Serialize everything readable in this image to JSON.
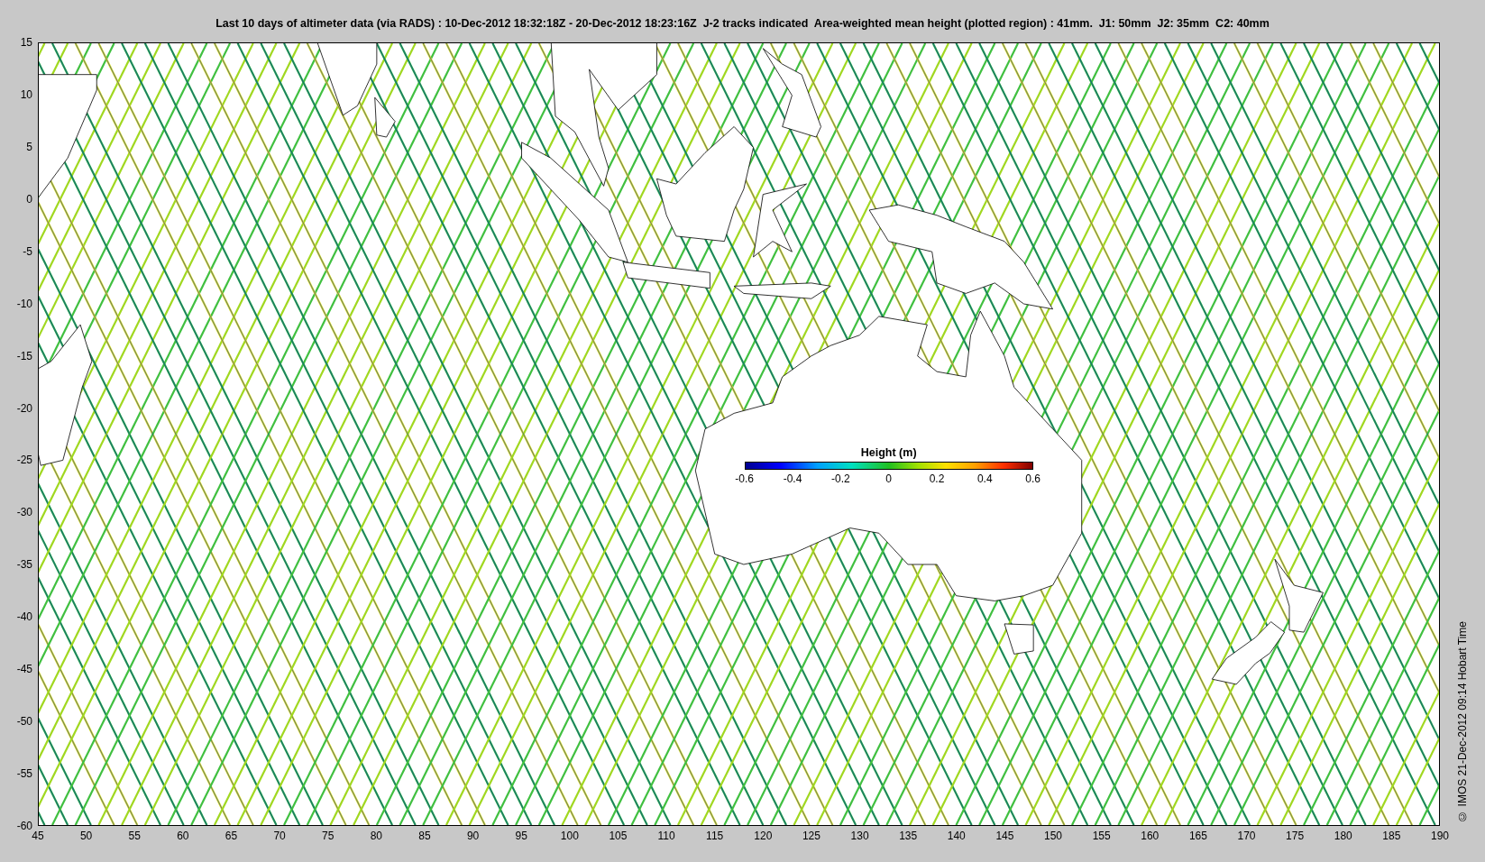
{
  "title": "Last 10 days of altimeter data (via RADS) : 10-Dec-2012 18:32:18Z - 20-Dec-2012 18:23:16Z  J-2 tracks indicated  Area-weighted mean height (plotted region) : 41mm.  J1: 50mm  J2: 35mm  C2: 40mm",
  "y_ticks": [
    "15",
    "10",
    "5",
    "0",
    "-5",
    "-10",
    "-15",
    "-20",
    "-25",
    "-30",
    "-35",
    "-40",
    "-45",
    "-50",
    "-55",
    "-60"
  ],
  "x_ticks": [
    "45",
    "50",
    "55",
    "60",
    "65",
    "70",
    "75",
    "80",
    "85",
    "90",
    "95",
    "100",
    "105",
    "110",
    "115",
    "120",
    "125",
    "130",
    "135",
    "140",
    "145",
    "150",
    "155",
    "160",
    "165",
    "170",
    "175",
    "180",
    "185",
    "190"
  ],
  "colorbar": {
    "label": "Height (m)",
    "ticks": [
      "-0.6",
      "-0.4",
      "-0.2",
      "0",
      "0.2",
      "0.4",
      "0.6"
    ]
  },
  "credit": "© IMOS 21-Dec-2012 09:14 Hobart Time"
}
